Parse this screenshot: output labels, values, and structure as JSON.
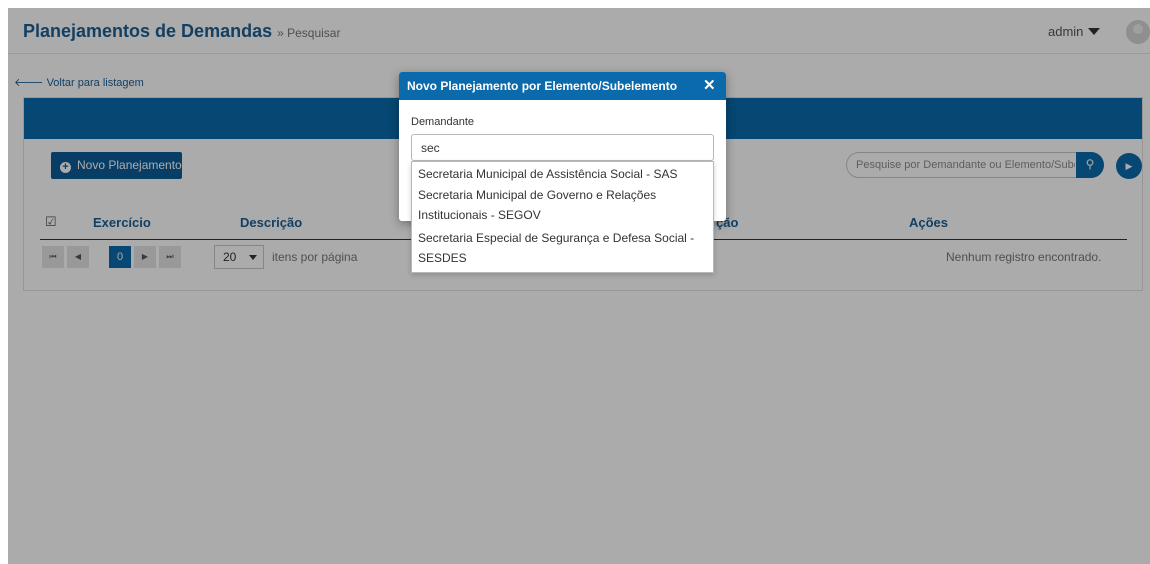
{
  "header": {
    "title": "Planejamentos de Demandas",
    "subtitle": "» Pesquisar",
    "user": "admin"
  },
  "back_link": "Voltar para listagem",
  "toolbar": {
    "new_button": "Novo Planejamento",
    "search_placeholder": "Pesquise por Demandante ou Elemento/Subelemento"
  },
  "table": {
    "columns": [
      "Exercício",
      "Descrição",
      "ção",
      "Ações"
    ],
    "empty_message": "Nenhum registro encontrado."
  },
  "pager": {
    "page": "0",
    "per_page": "20",
    "per_page_label": "itens por página"
  },
  "modal": {
    "title": "Novo Planejamento por Elemento/Subelemento",
    "field_label": "Demandante",
    "field_value": "sec",
    "options": [
      {
        "line1": "Secretaria Municipal de Assistência Social - SAS",
        "line2": ""
      },
      {
        "line1": "Secretaria Municipal de Governo e Relações",
        "line2": "Institucionais - SEGOV"
      },
      {
        "line1": "Secretaria Especial de Segurança e Defesa Social -",
        "line2": "SESDES"
      }
    ]
  },
  "icons": {
    "header": [
      "caret-down-icon",
      "avatar-icon"
    ],
    "toolbar": [
      "plus-circle-icon",
      "search-icon",
      "next-icon"
    ],
    "modal": [
      "close-icon"
    ]
  },
  "colors": {
    "brand_blue": "#0a6aac",
    "title_blue": "#1d5f94",
    "button_blue": "#0d5c99"
  }
}
